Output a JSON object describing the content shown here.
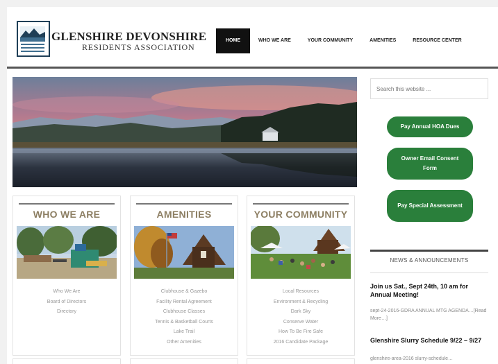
{
  "header": {
    "title": "GLENSHIRE DEVONSHIRE",
    "subtitle": "RESIDENTS ASSOCIATION"
  },
  "nav": {
    "items": [
      "HOME",
      "WHO WE ARE",
      "YOUR COMMUNITY",
      "AMENITIES",
      "RESOURCE CENTER"
    ]
  },
  "search": {
    "placeholder": "Search this website ..."
  },
  "sidebar": {
    "buttons": [
      "Pay Annual HOA Dues",
      "Owner Email Consent Form",
      "Pay Special Assessment"
    ],
    "news_heading": "NEWS & ANNOUNCEMENTS",
    "news": [
      {
        "title": "Join us Sat., Sept 24th, 10 am for Annual Meeting!",
        "excerpt": "sept-24-2016-GDRA ANNUAL MTG AGENDA…[Read More…]"
      },
      {
        "title": "Glenshire Slurry Schedule 9/22 – 9/27",
        "excerpt": "glenshire-area-2016 slurry-schedule…"
      }
    ]
  },
  "columns": [
    {
      "title": "WHO WE ARE",
      "links": [
        "Who We Are",
        "Board of Directors",
        "Directory"
      ]
    },
    {
      "title": "AMENITIES",
      "links": [
        "Clubhouse & Gazebo",
        "Facility Rental Agreement",
        "Clubhouse Classes",
        "Tennis & Basketball Courts",
        "Lake Trail",
        "Other Amenities"
      ]
    },
    {
      "title": "YOUR COMMUNITY",
      "links": [
        "Local Resources",
        "Environment & Recycling",
        "Dark Sky",
        "Conserve Water",
        "How To Be Fire Safe",
        "2016 Candidate Package"
      ]
    }
  ],
  "colors": {
    "accent_green": "#2a7f3b",
    "nav_active": "#111111",
    "column_title": "#8c7e62"
  },
  "icons": {
    "logo": "mountain-lake-logo"
  }
}
